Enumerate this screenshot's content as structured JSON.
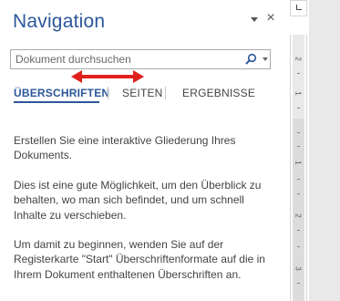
{
  "pane": {
    "title": "Navigation",
    "close_glyph": "×",
    "icons": {
      "pin": "dropdown-triangle-icon",
      "close": "close-icon",
      "search": "magnifier-icon"
    }
  },
  "search": {
    "placeholder": "Dokument durchsuchen",
    "value": ""
  },
  "tabs": [
    {
      "label": "ÜBERSCHRIFTEN",
      "active": true
    },
    {
      "label": "SEITEN",
      "active": false
    },
    {
      "label": "ERGEBNISSE",
      "active": false
    }
  ],
  "body": {
    "paragraph_1": "Erstellen Sie eine interaktive Gliederung Ihres Dokuments.",
    "paragraph_2": "Dies ist eine gute Möglichkeit, um den Überblick zu behalten, wo man sich befindet, und um schnell Inhalte zu verschieben.",
    "paragraph_3": "Um damit zu beginnen, wenden Sie auf der Registerkarte \"Start\" Überschriftenformate auf die in Ihrem Dokument enthaltenen Überschriften an."
  },
  "ruler": {
    "labels": [
      "2",
      "1",
      "1",
      "2",
      "3"
    ]
  },
  "colors": {
    "accent": "#2b579a",
    "annotation_arrow": "#e0201b",
    "text": "#444444"
  }
}
